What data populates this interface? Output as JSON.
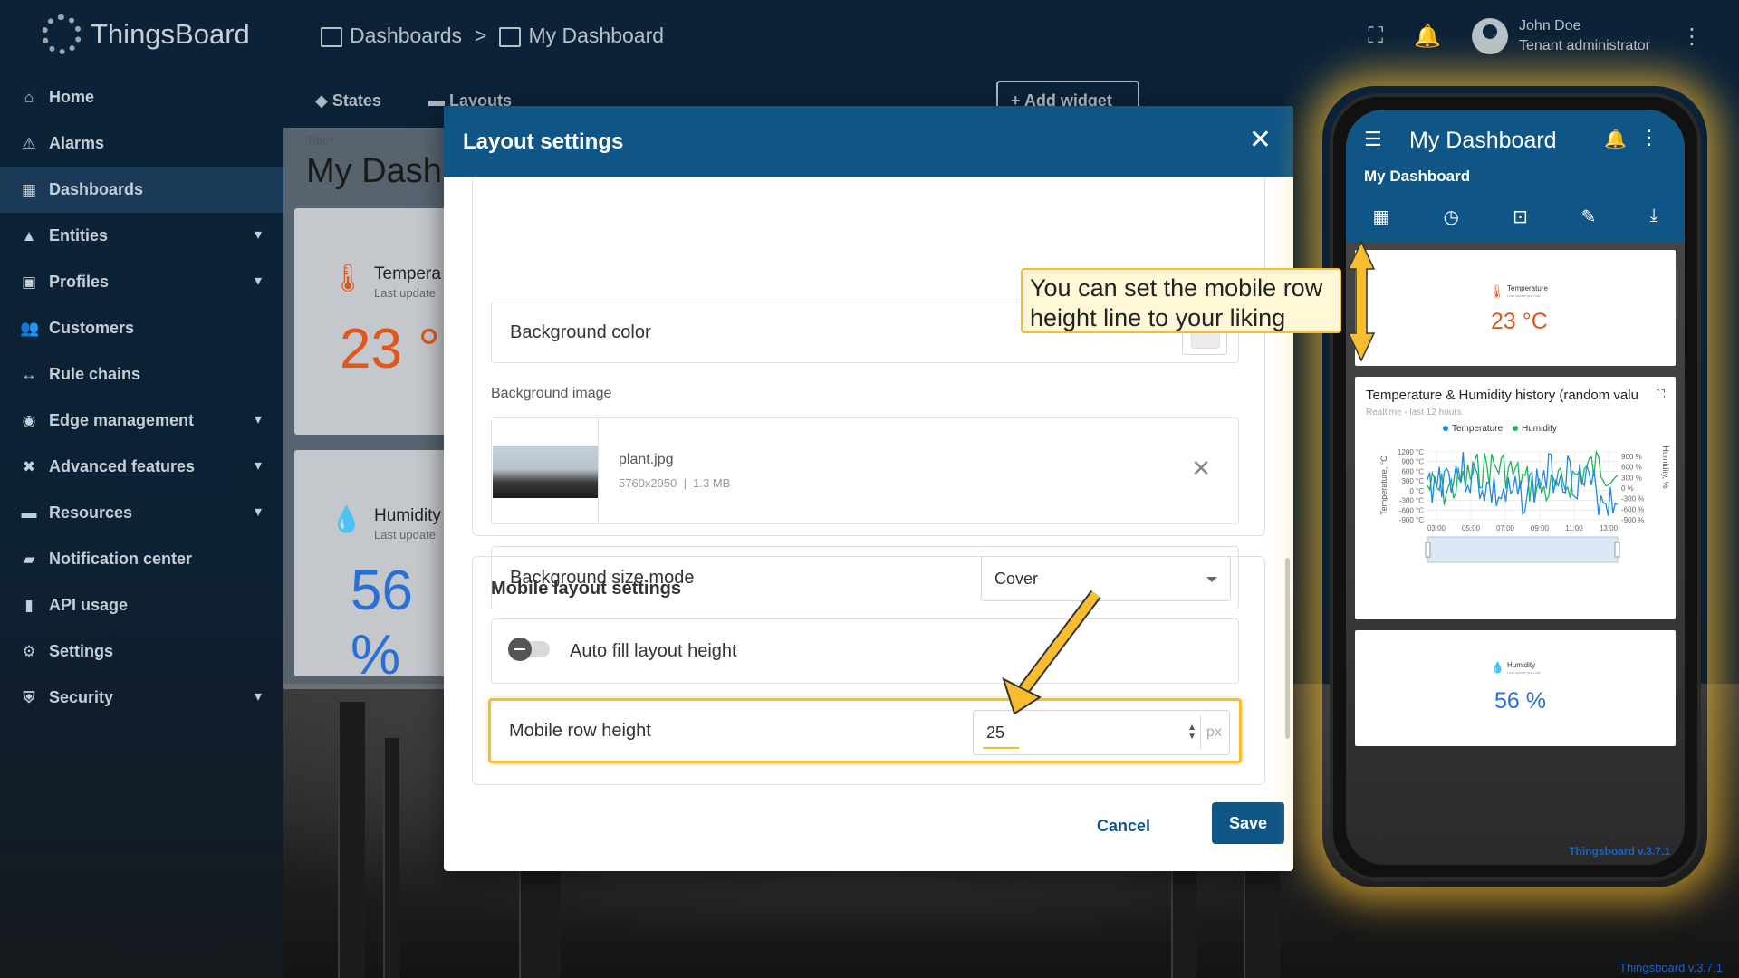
{
  "app": {
    "logo_text": "ThingsBoard",
    "breadcrumb": [
      {
        "label": "Dashboards"
      },
      {
        "label": "My Dashboard"
      }
    ],
    "breadcrumb_separator": ">",
    "user_name": "John Doe",
    "user_role": "Tenant administrator"
  },
  "sidebar": {
    "items": [
      {
        "label": "Home",
        "icon": "home-icon",
        "glyph": "⌂"
      },
      {
        "label": "Alarms",
        "icon": "alarm-icon",
        "glyph": "⚠"
      },
      {
        "label": "Dashboards",
        "icon": "dashboard-icon",
        "glyph": "▦"
      },
      {
        "label": "Entities",
        "icon": "entities-icon",
        "glyph": "▲"
      },
      {
        "label": "Profiles",
        "icon": "profiles-icon",
        "glyph": "▣"
      },
      {
        "label": "Customers",
        "icon": "customers-icon",
        "glyph": "👥"
      },
      {
        "label": "Rule chains",
        "icon": "rule-chains-icon",
        "glyph": "↔"
      },
      {
        "label": "Edge management",
        "icon": "edge-icon",
        "glyph": "◉"
      },
      {
        "label": "Advanced features",
        "icon": "tools-icon",
        "glyph": "✖"
      },
      {
        "label": "Resources",
        "icon": "folder-icon",
        "glyph": "▬"
      },
      {
        "label": "Notification center",
        "icon": "notification-icon",
        "glyph": "▰"
      },
      {
        "label": "API usage",
        "icon": "api-usage-icon",
        "glyph": "▮"
      },
      {
        "label": "Settings",
        "icon": "settings-icon",
        "glyph": "⚙"
      },
      {
        "label": "Security",
        "icon": "security-icon",
        "glyph": "⛨"
      }
    ]
  },
  "dashboard": {
    "toolbar_states": "States",
    "toolbar_layouts": "Layouts",
    "toolbar_add_widget": "+ Add widget",
    "title_label": "Title*",
    "title": "My Dash",
    "temp_title": "Tempera",
    "temp_sub": "Last update",
    "temp_value": "23 °",
    "hum_title": "Humidity",
    "hum_sub": "Last update",
    "hum_value": "56 %"
  },
  "modal": {
    "title": "Layout settings",
    "bg_color_label": "Background color",
    "bg_image_label": "Background image",
    "image_name": "plant.jpg",
    "image_dims": "5760x2950",
    "image_size": "1.3 MB",
    "bg_size_mode_label": "Background size mode",
    "bg_size_mode_value": "Cover",
    "mobile_section_title": "Mobile layout settings",
    "auto_fill_label": "Auto fill layout height",
    "auto_fill_on": false,
    "row_height_label": "Mobile row height",
    "row_height_value": "25",
    "row_height_unit": "px",
    "cancel_label": "Cancel",
    "save_label": "Save"
  },
  "callout": {
    "line1": "You can set the mobile row",
    "line2": "height line to your liking"
  },
  "phone": {
    "header_title": "My Dashboard",
    "subtitle": "My Dashboard",
    "temp_title": "Temperature",
    "temp_sub": "Last update just now",
    "temp_value": "23 °C",
    "chart_title": "Temperature & Humidity history (random valu",
    "chart_sub": "Realtime - last 12 hours",
    "legend_temp": "Temperature",
    "legend_hum": "Humidity",
    "y_left_label": "Temperature, °C",
    "y_right_label": "Humidity, %",
    "y_left_ticks": [
      "1200 °C",
      "900 °C",
      "600 °C",
      "300 °C",
      "0 °C",
      "-300 °C",
      "-600 °C",
      "-900 °C"
    ],
    "y_right_ticks": [
      "900 %",
      "600 %",
      "300 %",
      "0 %",
      "-300 %",
      "-600 %",
      "-900 %"
    ],
    "x_ticks": [
      "03:00",
      "05:00",
      "07:00",
      "09:00",
      "11:00",
      "13:00"
    ],
    "hum_title": "Humidity",
    "hum_sub": "Last update just now",
    "hum_value": "56 %",
    "version": "Thingsboard v.3.7.1"
  },
  "page_version": "Thingsboard v.3.7.1",
  "colors": {
    "primary": "#0f5586",
    "accent": "#f7bd2f",
    "temp": "#e0561b",
    "humidity": "#2a6fd6"
  }
}
